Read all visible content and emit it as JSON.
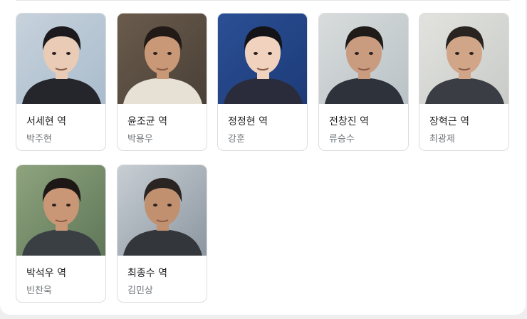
{
  "cast": [
    {
      "role": "서세현 역",
      "actor": "박주현",
      "bg": "#a9bccd",
      "bg2": "#c7d2dc",
      "skin": "#e9cbb6",
      "hair": "#1c1a1c",
      "shirt": "#25262b"
    },
    {
      "role": "윤조균 역",
      "actor": "박용우",
      "bg": "#4a4037",
      "bg2": "#6a5b4c",
      "skin": "#c99877",
      "hair": "#221a16",
      "shirt": "#e6e0d5"
    },
    {
      "role": "정정현 역",
      "actor": "강훈",
      "bg": "#1c3b78",
      "bg2": "#2b4f95",
      "skin": "#f0d2be",
      "hair": "#141418",
      "shirt": "#2a2c3c"
    },
    {
      "role": "전창진 역",
      "actor": "류승수",
      "bg": "#b9c2c6",
      "bg2": "#d8dcdc",
      "skin": "#c99c80",
      "hair": "#1f1b19",
      "shirt": "#2e323a"
    },
    {
      "role": "장혁근 역",
      "actor": "최광제",
      "bg": "#c9cbc8",
      "bg2": "#e2e3df",
      "skin": "#d1a688",
      "hair": "#2a2421",
      "shirt": "#3a3d44"
    },
    {
      "role": "박석우 역",
      "actor": "빈찬욱",
      "bg": "#5f7758",
      "bg2": "#8ea37e",
      "skin": "#c99676",
      "hair": "#1d1816",
      "shirt": "#3a3f44"
    },
    {
      "role": "최종수 역",
      "actor": "김민상",
      "bg": "#8c96a0",
      "bg2": "#c7ced4",
      "skin": "#c0906f",
      "hair": "#2a2522",
      "shirt": "#33373c"
    }
  ]
}
